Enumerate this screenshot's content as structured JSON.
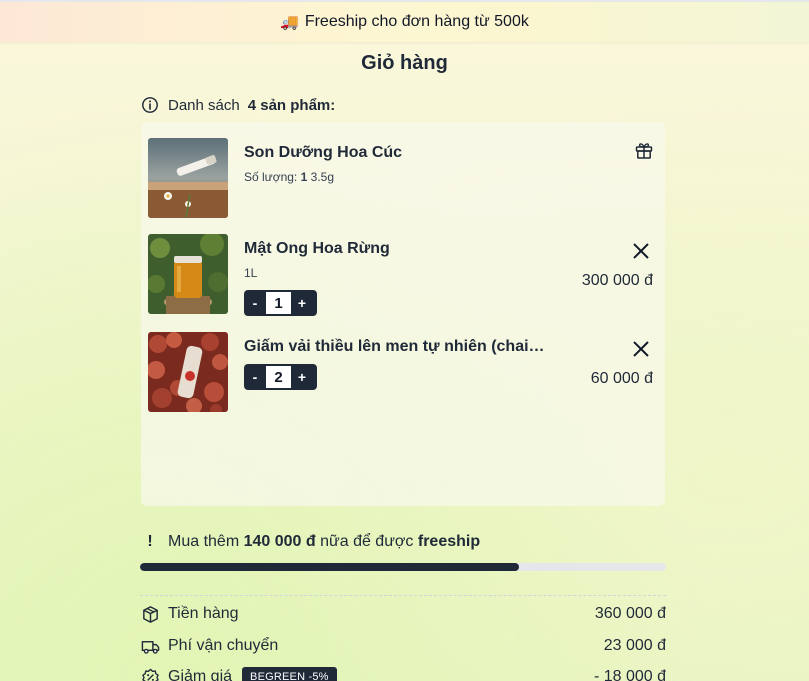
{
  "banner": {
    "icon": "truck-icon",
    "text": "Freeship cho đơn hàng từ 500k"
  },
  "page": {
    "title": "Giỏ hàng"
  },
  "list_header": {
    "prefix": "Danh sách",
    "count_text": "4 sản phẩm:"
  },
  "cart_items": [
    {
      "name": "Son Dưỡng Hoa Cúc",
      "qty_label": "Số lượng:",
      "qty_value": "1",
      "variant": "3.5g",
      "badge_icon": "gift-icon"
    },
    {
      "name": "Mật Ong Hoa Rừng",
      "variant": "1L",
      "quantity": "1",
      "price": "300 000 đ"
    },
    {
      "name": "Giấm vải thiều lên men tự nhiên (chai…",
      "quantity": "2",
      "price": "60 000 đ"
    }
  ],
  "freeship_note": {
    "prefix": "Mua thêm",
    "amount": "140 000 đ",
    "middle": "nữa để được",
    "suffix": "freeship",
    "progress_fraction": 0.72
  },
  "summary": {
    "subtotal_label": "Tiền hàng",
    "subtotal_value": "360 000 đ",
    "shipping_label": "Phí vận chuyển",
    "shipping_value": "23 000 đ",
    "discount_label": "Giảm giá",
    "discount_code": "BEGREEN -5%",
    "discount_value": "- 18 000 đ"
  },
  "colors": {
    "accent": "#1f2937",
    "progress_track": "#e5e7eb"
  }
}
